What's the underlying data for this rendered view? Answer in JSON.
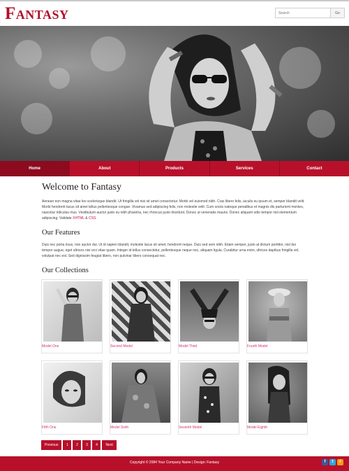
{
  "header": {
    "logo": "Fantasy",
    "search_placeholder": "Search",
    "search_button": "Go"
  },
  "nav": {
    "items": [
      "Home",
      "About",
      "Products",
      "Services",
      "Contact"
    ],
    "active": "Home"
  },
  "main": {
    "welcome_title": "Welcome to Fantasy",
    "welcome_text": "Aenean non magna vitae leo scelerisque blandit. Ut fringilla vel nisi sit amet consectetur. Morbi vel euismod nibh. Cras libero felis, iaculis eu ipsum et, semper blandit velit. Morbi hendrerit lacus sit amet tellus pellentesque congue. Vivamus sed adipiscing felis, non molestie velit. Cum sociis natoque penatibus et magnis dis parturient montes, nascetur ridiculus mus. Vestibulum auctor justo eu nibh pharetra, nec rhoncus justo tincidunt. Donec ut venenatis mauris. Donec aliquam odio tempor nisl elementum adipiscing. Validate",
    "validate_xhtml": "XHTML",
    "validate_amp": "&",
    "validate_css": "CSS",
    "validate_end": ".",
    "features_title": "Our Features",
    "features_text": "Duis nec porta risus, non auctor dui. Ut id sapien blandit, molestie lacus sit amet, hendrerit neque. Duis sed sem nibh. Etiam semper, justo at dictum porttitor, nisl dui tempor augue, eget ultrices nisi orci vitae quam. Integer id tellus consectetur, pellentesque neque nec, aliquam ligula. Curabitur urna enim, ultrices dapibus fringilla vel, volutpat nec est. Sed dignissim feugiat libero, non pulvinar libero consequat nec.",
    "collections_title": "Our Collections",
    "collections": [
      {
        "caption": "Model One"
      },
      {
        "caption": "Second Model"
      },
      {
        "caption": "Model Third"
      },
      {
        "caption": "Fourth Model"
      },
      {
        "caption": "Fifth One"
      },
      {
        "caption": "Model Sixth"
      },
      {
        "caption": "Seventh Model"
      },
      {
        "caption": "Model Eighth"
      }
    ]
  },
  "pager": {
    "previous": "Previous",
    "pages": [
      "1",
      "2",
      "3",
      "4"
    ],
    "next": "Next"
  },
  "footer": {
    "copyright": "Copyright © 2084 Your Company Name | Design: Fantasy"
  },
  "colors": {
    "brand": "#b8102b",
    "caption": "#d0337a"
  }
}
